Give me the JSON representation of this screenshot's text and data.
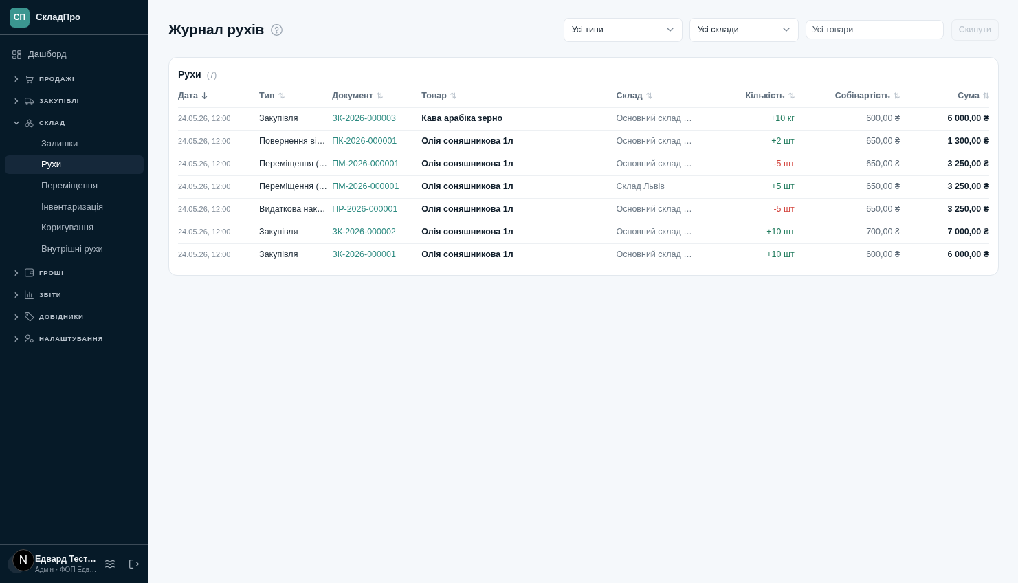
{
  "sidebar": {
    "brand": {
      "logo": "СП",
      "name": "СкладПро"
    },
    "nav": [
      {
        "kind": "link",
        "label": "Дашборд"
      },
      {
        "kind": "group",
        "label": "ПРОДАЖІ",
        "expanded": false
      },
      {
        "kind": "group",
        "label": "ЗАКУПІВЛІ",
        "expanded": false
      },
      {
        "kind": "group",
        "label": "СКЛАД",
        "expanded": true,
        "children": [
          {
            "label": "Залишки",
            "selected": false
          },
          {
            "label": "Рухи",
            "selected": true
          },
          {
            "label": "Переміщення",
            "selected": false
          },
          {
            "label": "Інвентаризація",
            "selected": false
          },
          {
            "label": "Коригування",
            "selected": false
          },
          {
            "label": "Внутрішні рухи",
            "selected": false
          }
        ]
      },
      {
        "kind": "group",
        "label": "ГРОШІ",
        "expanded": false
      },
      {
        "kind": "group",
        "label": "ЗВІТИ",
        "expanded": false
      },
      {
        "kind": "group",
        "label": "ДОВІДНИКИ",
        "expanded": false
      },
      {
        "kind": "group",
        "label": "НАЛАШТУВАННЯ",
        "expanded": false
      }
    ],
    "user": {
      "name": "Едвард Тест…",
      "subtitle": "Адмін · ФОП Едв…"
    },
    "dev_badge": "N"
  },
  "header": {
    "title": "Журнал рухів",
    "filters": [
      {
        "kind": "select",
        "value": "Усі типи"
      },
      {
        "kind": "select",
        "value": "Усі склади"
      },
      {
        "kind": "input",
        "placeholder": "Усі товари"
      }
    ],
    "reset_button": {
      "label": "Скинути",
      "disabled": true
    }
  },
  "card": {
    "title": "Рухи",
    "count": "(7)"
  },
  "table": {
    "columns": [
      {
        "label": "Дата",
        "kind": "date",
        "sorted": true
      },
      {
        "label": "Тип",
        "kind": "text",
        "sorted": false
      },
      {
        "label": "Документ",
        "kind": "link",
        "sorted": false
      },
      {
        "label": "Товар",
        "kind": "strong",
        "sorted": false
      },
      {
        "label": "Склад",
        "kind": "muted",
        "sorted": false
      },
      {
        "label": "Кількість",
        "kind": "quantity",
        "sorted": false
      },
      {
        "label": "Собівартість",
        "kind": "money",
        "sorted": false
      },
      {
        "label": "Сума",
        "kind": "total",
        "sorted": false
      }
    ],
    "rows": [
      {
        "cells": [
          "24.05.26, 12:00",
          "Закупівля",
          "ЗК-2026-000003",
          "Кава арабіка зерно",
          "Основний склад …",
          "+10 кг",
          "600,00 ₴",
          "6 000,00 ₴"
        ],
        "color": "#1f7a5c"
      },
      {
        "cells": [
          "24.05.26, 12:00",
          "Повернення ві…",
          "ПК-2026-000001",
          "Олія соняшникова 1л",
          "Основний склад …",
          "+2 шт",
          "650,00 ₴",
          "1 300,00 ₴"
        ],
        "color": "#1f7a5c"
      },
      {
        "cells": [
          "24.05.26, 12:00",
          "Переміщення (…",
          "ПМ-2026-000001",
          "Олія соняшникова 1л",
          "Основний склад …",
          "-5 шт",
          "650,00 ₴",
          "3 250,00 ₴"
        ],
        "color": "#d3453e"
      },
      {
        "cells": [
          "24.05.26, 12:00",
          "Переміщення (…",
          "ПМ-2026-000001",
          "Олія соняшникова 1л",
          "Склад Львів",
          "+5 шт",
          "650,00 ₴",
          "3 250,00 ₴"
        ],
        "color": "#1f7a5c"
      },
      {
        "cells": [
          "24.05.26, 12:00",
          "Видаткова нак…",
          "ПР-2026-000001",
          "Олія соняшникова 1л",
          "Основний склад …",
          "-5 шт",
          "650,00 ₴",
          "3 250,00 ₴"
        ],
        "color": "#d3453e"
      },
      {
        "cells": [
          "24.05.26, 12:00",
          "Закупівля",
          "ЗК-2026-000002",
          "Олія соняшникова 1л",
          "Основний склад …",
          "+10 шт",
          "700,00 ₴",
          "7 000,00 ₴"
        ],
        "color": "#1f7a5c"
      },
      {
        "cells": [
          "24.05.26, 12:00",
          "Закупівля",
          "ЗК-2026-000001",
          "Олія соняшникова 1л",
          "Основний склад …",
          "+10 шт",
          "600,00 ₴",
          "6 000,00 ₴"
        ],
        "color": "#1f7a5c"
      }
    ]
  }
}
